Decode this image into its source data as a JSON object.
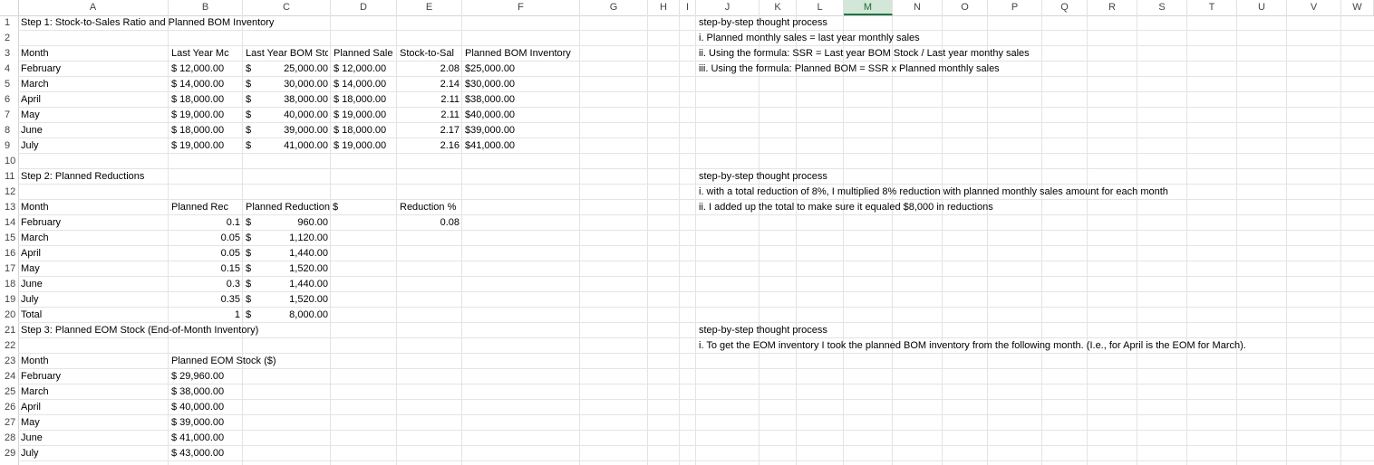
{
  "columns": [
    "A",
    "B",
    "C",
    "D",
    "E",
    "F",
    "G",
    "H",
    "I",
    "J",
    "K",
    "L",
    "M",
    "N",
    "O",
    "P",
    "Q",
    "R",
    "S",
    "T",
    "U",
    "V",
    "W"
  ],
  "selected_column": "M",
  "step1": {
    "title": "Step 1: Stock-to-Sales Ratio and Planned BOM Inventory",
    "headers": [
      "Month",
      "Last Year Mc",
      "Last Year BOM Stocl",
      "Planned Sale",
      "Stock-to-Sal",
      "Planned BOM Inventory"
    ],
    "rows": [
      {
        "month": "February",
        "ly_sales": "$ 12,000.00",
        "ly_bom_sym": "$",
        "ly_bom": "25,000.00",
        "planned_sales": "$  12,000.00",
        "ssr": "2.08",
        "planned_bom": "$25,000.00"
      },
      {
        "month": "March",
        "ly_sales": "$ 14,000.00",
        "ly_bom_sym": "$",
        "ly_bom": "30,000.00",
        "planned_sales": "$  14,000.00",
        "ssr": "2.14",
        "planned_bom": "$30,000.00"
      },
      {
        "month": "April",
        "ly_sales": "$ 18,000.00",
        "ly_bom_sym": "$",
        "ly_bom": "38,000.00",
        "planned_sales": "$  18,000.00",
        "ssr": "2.11",
        "planned_bom": "$38,000.00"
      },
      {
        "month": "May",
        "ly_sales": "$ 19,000.00",
        "ly_bom_sym": "$",
        "ly_bom": "40,000.00",
        "planned_sales": "$  19,000.00",
        "ssr": "2.11",
        "planned_bom": "$40,000.00"
      },
      {
        "month": "June",
        "ly_sales": "$ 18,000.00",
        "ly_bom_sym": "$",
        "ly_bom": "39,000.00",
        "planned_sales": "$  18,000.00",
        "ssr": "2.17",
        "planned_bom": "$39,000.00"
      },
      {
        "month": "July",
        "ly_sales": "$ 19,000.00",
        "ly_bom_sym": "$",
        "ly_bom": "41,000.00",
        "planned_sales": "$  19,000.00",
        "ssr": "2.16",
        "planned_bom": "$41,000.00"
      }
    ],
    "notes": [
      "step-by-step thought process",
      "i. Planned monthly sales = last year monthly sales",
      "ii. Using the formula: SSR = Last year BOM Stock / Last year monthy sales",
      "iii. Using the formula: Planned BOM = SSR x Planned monthly sales"
    ]
  },
  "step2": {
    "title": "Step 2: Planned Reductions",
    "headers": [
      "Month",
      "Planned Rec",
      "Planned Reduction $",
      "Reduction %"
    ],
    "reduction_pct": "0.08",
    "rows": [
      {
        "month": "February",
        "pct": "0.1",
        "sym": "$",
        "amount": "960.00"
      },
      {
        "month": "March",
        "pct": "0.05",
        "sym": "$",
        "amount": "1,120.00"
      },
      {
        "month": "April",
        "pct": "0.05",
        "sym": "$",
        "amount": "1,440.00"
      },
      {
        "month": "May",
        "pct": "0.15",
        "sym": "$",
        "amount": "1,520.00"
      },
      {
        "month": "June",
        "pct": "0.3",
        "sym": "$",
        "amount": "1,440.00"
      },
      {
        "month": "July",
        "pct": "0.35",
        "sym": "$",
        "amount": "1,520.00"
      },
      {
        "month": "Total",
        "pct": "1",
        "sym": "$",
        "amount": "8,000.00"
      }
    ],
    "notes": [
      "step-by-step thought process",
      "i. with a total reduction of 8%, I multiplied 8% reduction with planned monthly sales amount for each month",
      "ii. I added up the total to make sure it equaled $8,000 in reductions"
    ]
  },
  "step3": {
    "title": "Step 3: Planned EOM Stock (End-of-Month Inventory)",
    "headers": [
      "Month",
      "Planned EOM Stock ($)"
    ],
    "rows": [
      {
        "month": "February",
        "eom": "$ 29,960.00"
      },
      {
        "month": "March",
        "eom": "$ 38,000.00"
      },
      {
        "month": "April",
        "eom": "$ 40,000.00"
      },
      {
        "month": "May",
        "eom": "$ 39,000.00"
      },
      {
        "month": "June",
        "eom": "$ 41,000.00"
      },
      {
        "month": "July",
        "eom": "$ 43,000.00"
      }
    ],
    "notes": [
      "step-by-step thought process",
      "i. To get the EOM inventory I took the planned BOM inventory from the following month. (I.e., for April is the EOM for March)."
    ]
  }
}
